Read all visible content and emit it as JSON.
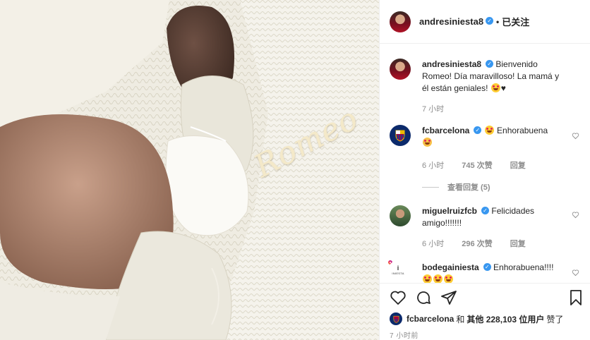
{
  "photo": {
    "overlay_text": "Romeo"
  },
  "header": {
    "username": "andresiniesta8",
    "verified_icon": "✓",
    "separator": "•",
    "follow_label": "已关注"
  },
  "caption": {
    "username": "andresiniesta8",
    "text": "Bienvenido Romeo! Día maravilloso! La mamá y él están geniales!",
    "emoji": "😍",
    "heart": "♥",
    "time": "7 小时"
  },
  "comments": [
    {
      "username": "fcbarcelona",
      "text": "Enhorabuena",
      "time": "6 小时",
      "likes": "745 次赞",
      "reply": "回复"
    },
    {
      "username": "miguelruizfcb",
      "text": "Felicidades amigo!!!!!!!",
      "time": "6 小时",
      "likes": "296 次赞",
      "reply": "回复"
    },
    {
      "username": "bodegainiesta",
      "text": "Enhorabuena!!!!",
      "avatar_text": "INIESTA"
    }
  ],
  "view_replies": "查看回复 (5)",
  "likes_line": {
    "first_user": "fcbarcelona",
    "connector": "和",
    "others": "其他 228,103 位用户",
    "suffix": "赞了"
  },
  "post_time": "7 小时前",
  "colors": {
    "verified": "#3897f0",
    "muted": "#8e8e8e",
    "text": "#262626"
  }
}
